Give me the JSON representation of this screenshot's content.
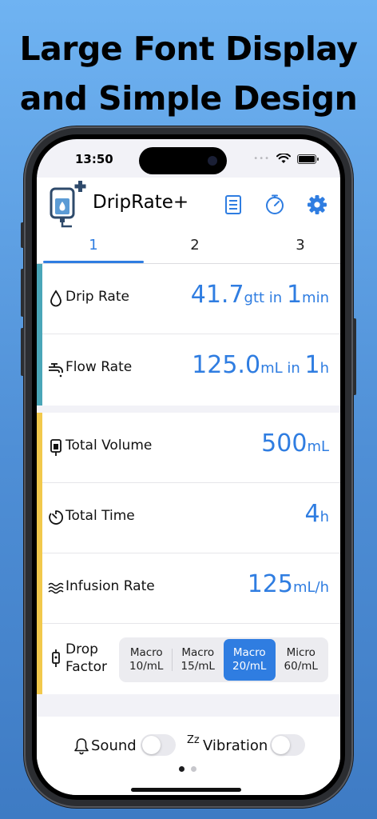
{
  "headline": {
    "line1": "Large Font Display",
    "line2": "and Simple Design"
  },
  "status": {
    "time": "13:50",
    "dots": "•••"
  },
  "app": {
    "title": "DripRate+"
  },
  "tabs": [
    {
      "label": "1"
    },
    {
      "label": "2"
    },
    {
      "label": "3"
    }
  ],
  "rate_rows": [
    {
      "label": "Drip Rate",
      "value1": "41.7",
      "unit1": "gtt in ",
      "value2": "1",
      "unit2": "min"
    },
    {
      "label": "Flow Rate",
      "value1": "125.0",
      "unit1": "mL in ",
      "value2": "1",
      "unit2": "h"
    }
  ],
  "calc_rows": [
    {
      "label": "Total Volume",
      "value": "500",
      "unit": "mL"
    },
    {
      "label": "Total Time",
      "value": "4",
      "unit": "h"
    },
    {
      "label": "Infusion Rate",
      "value": "125",
      "unit": "mL/h"
    }
  ],
  "drop_factor": {
    "label_line1": "Drop",
    "label_line2": "Factor",
    "options": [
      {
        "line1": "Macro",
        "line2": "10/mL"
      },
      {
        "line1": "Macro",
        "line2": "15/mL"
      },
      {
        "line1": "Macro",
        "line2": "20/mL"
      },
      {
        "line1": "Micro",
        "line2": "60/mL"
      }
    ],
    "selected_index": 2
  },
  "settings": {
    "sound_label": "Sound",
    "sound_on": false,
    "vibration_label": "Vibration",
    "vibration_on": false,
    "zz_glyph": "Zz"
  },
  "colors": {
    "accent": "#2f7de1",
    "bar_rate": "#4aa6b8",
    "bar_calc": "#f2c94c"
  },
  "icons": {
    "drip": "drop-icon",
    "flow": "faucet-icon",
    "volume": "iv-bag-icon",
    "time": "timer-icon",
    "infusion": "waves-icon",
    "factor": "drip-chamber-icon",
    "list": "list-icon",
    "timer_tb": "stopwatch-icon",
    "settings": "gear-icon",
    "sound": "bell-icon",
    "vibration": "zz-icon"
  }
}
